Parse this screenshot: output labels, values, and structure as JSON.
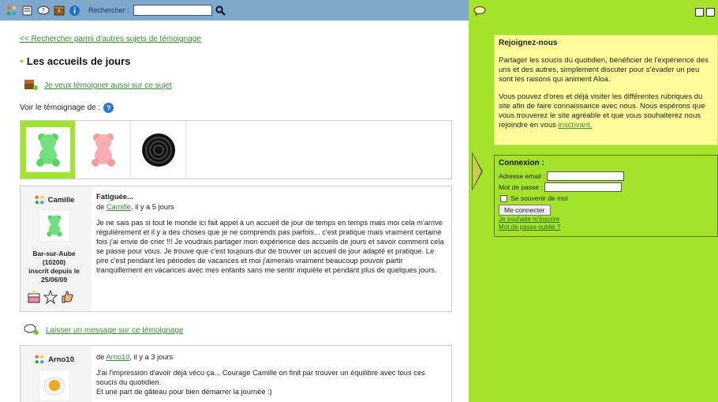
{
  "toolbar": {
    "icons": [
      "pawprint-icon",
      "book-icon",
      "chat-question-icon",
      "chest-icon",
      "info-icon"
    ],
    "search_label": "Rechercher :",
    "search_value": "",
    "search_button_icon": "magnifier-icon"
  },
  "main": {
    "back_link": "<< Rechercher parmi d'autres sujets de témoignage",
    "title": "Les accueils de jours",
    "testify_link": "Je veux témoigner aussi sur ce sujet",
    "voir_label": "Voir le témoignage de :",
    "picker": [
      "green-bear",
      "pink-bear",
      "licorice"
    ],
    "leave_message_link": "Laisser un message sur ce témoignage"
  },
  "cards": [
    {
      "author": "Camille",
      "location": "Bar-sur-Aube (10200)",
      "since": "inscrit depuis le 25/06/09",
      "headline": "Fatiguée...",
      "by_prefix": "de",
      "by_name": "Camille",
      "by_suffix": ", il y a 5 jours",
      "text": "Je ne sais pas si tout le monde ici fait appel à un accueil de jour de temps en temps mais moi cela m'arrive régulièrement et il y a des choses que je ne comprends pas parfois... c'est pratique mais vraiment certaine fois j'ai envie de crier !!! Je voudrais partager mon expérience des accueils de jours et savoir comment cela se passe pour vous. Je trouve que c'est toujours dur de trouver un accueil de jour adapté et pratique. Le pire c'est pendant les périodes de vacances et moi j'aimerais vraiment beaucoup pouvoir partir tranquillement en vacances avec mes enfants sans me sentir inquiète et pendant plus de quelques jours."
    },
    {
      "author": "Arno10",
      "by_prefix": "de",
      "by_name": "Arno10",
      "by_suffix": ", il y a 3 jours",
      "text1": "J'ai l'impression d'avoir déjà vécu ça... Courage Camille on finit par trouver un équilibre avec tous ces soucis du quotidien.",
      "text2": "Et une part de gâteau pour bien démarrer la journée :)"
    }
  ],
  "right": {
    "join_title": "Rejoignez-nous",
    "join_p1": "Partager les soucis du quotidien, bénéficier de l'expérience des uns et des autres, simplement discuter pour s'évader un peu sont les raisons qui animent Aloa.",
    "join_p2_pre": "Vous pouvez d'ores et déjà visiter les différentes rubriques du site afin de faire connaissance avec nous. Nous espérons que vous trouverez le site agréable et que vous souhaiterez nous rejoindre en vous",
    "join_p2_link": "inscrivant.",
    "login_title": "Connexion :",
    "email_label": "Adresse email :",
    "password_label": "Mot de passe :",
    "remember": "Se souvenir de moi",
    "connect_button": "Me connecter",
    "register_link": "Je souhaite m'inscrire",
    "forgot_link": "Mot de passe oublié ?"
  }
}
